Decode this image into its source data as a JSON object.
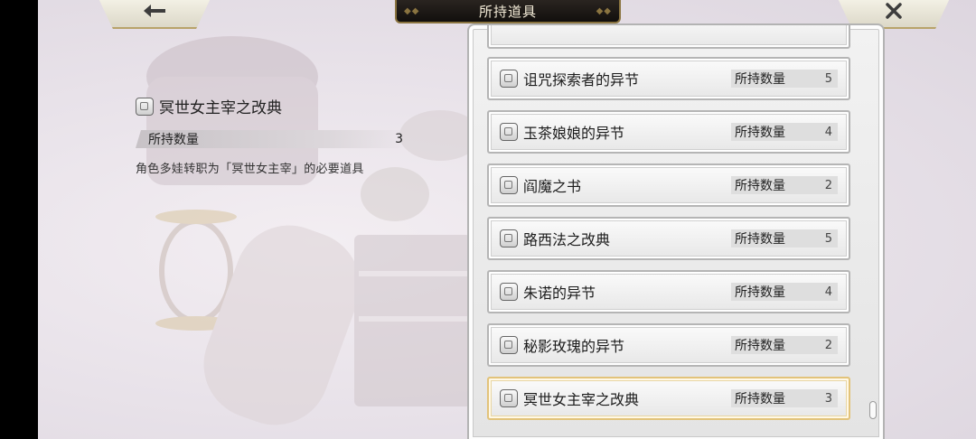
{
  "header": {
    "title": "所持道具",
    "back_icon": "arrow-left-icon",
    "close_icon": "close-icon"
  },
  "detail": {
    "name": "冥世女主宰之改典",
    "qty_label": "所持数量",
    "qty_value": "3",
    "description": "角色多娃转职为「冥世女主宰」的必要道具"
  },
  "list": {
    "items": [
      {
        "name": "诅咒探索者的异节",
        "qty_label": "所持数量",
        "qty": "5"
      },
      {
        "name": "玉茶娘娘的异节",
        "qty_label": "所持数量",
        "qty": "4"
      },
      {
        "name": "阎魔之书",
        "qty_label": "所持数量",
        "qty": "2"
      },
      {
        "name": "路西法之改典",
        "qty_label": "所持数量",
        "qty": "5"
      },
      {
        "name": "朱诺的异节",
        "qty_label": "所持数量",
        "qty": "4"
      },
      {
        "name": "秘影玫瑰的异节",
        "qty_label": "所持数量",
        "qty": "2"
      },
      {
        "name": "冥世女主宰之改典",
        "qty_label": "所持数量",
        "qty": "3",
        "selected": true
      }
    ]
  },
  "colors": {
    "selected_border": "#e2c37a",
    "title_bar": "#1a1613",
    "accent_gold": "#b8a36a"
  }
}
